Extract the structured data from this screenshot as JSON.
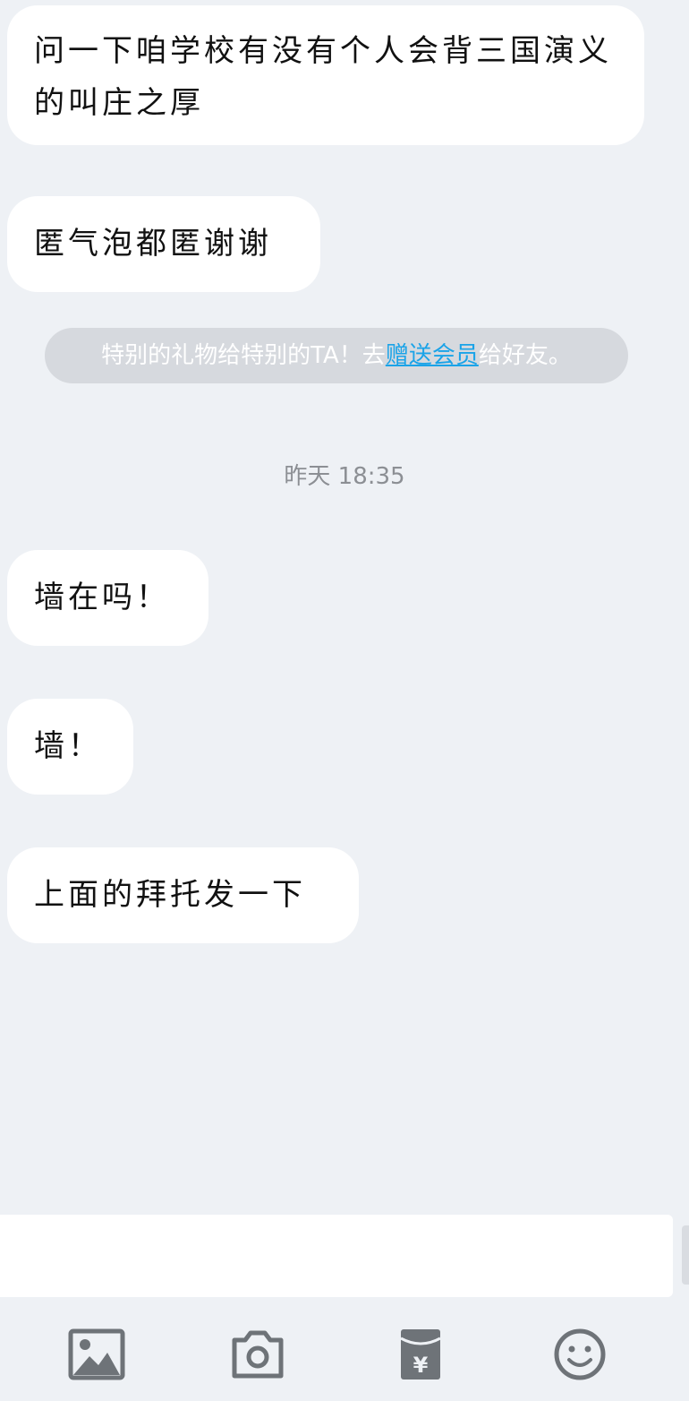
{
  "messages": [
    {
      "text": "问一下咱学校有没有个人会背三国演义的叫庄之厚"
    },
    {
      "text": "匿气泡都匿谢谢"
    },
    {
      "text": "墙在吗！"
    },
    {
      "text": "墙！"
    },
    {
      "text": "上面的拜托发一下"
    }
  ],
  "notice": {
    "prefix": "特别的礼物给特别的TA！去",
    "link": "赠送会员",
    "suffix": "给好友。"
  },
  "timestamp": "昨天 18:35",
  "input": {
    "value": ""
  },
  "toolbar": {
    "icons": [
      "image-icon",
      "camera-icon",
      "red-packet-icon",
      "emoji-icon"
    ]
  },
  "colors": {
    "background": "#eef1f5",
    "bubble": "#ffffff",
    "link": "#1aa3e8",
    "notice_bg": "#d6d9de",
    "icon": "#6e7378"
  }
}
